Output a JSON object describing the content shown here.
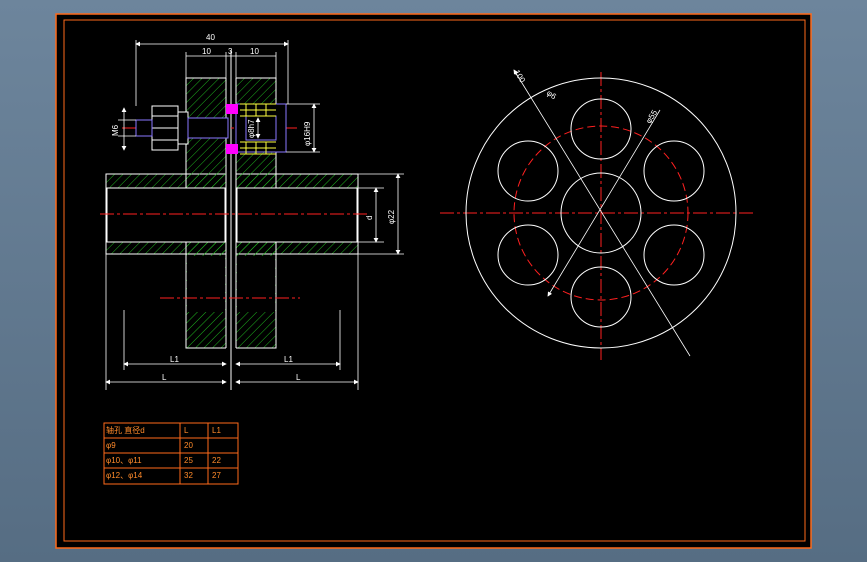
{
  "colors": {
    "background": "#000000",
    "frame": "#ff6a1a",
    "outline": "#ffffff",
    "dimension": "#ffffff",
    "centerline": "#ff2020",
    "hatch": "#1fb51f",
    "bolt": "#8a78ff",
    "bolt_marker": "#ff00ff",
    "spring": "#ffff40",
    "table": "#ff6a1a"
  },
  "dimensions": {
    "overall": "40",
    "left_flange": "10",
    "gap": "3",
    "right_flange": "10",
    "thread": "M6",
    "bolt_pin": "φ8h7",
    "bolt_hole": "φ16H9",
    "bore": "d",
    "hub_dia": "φ22",
    "l1_left": "L1",
    "l1_right": "L1",
    "l_left": "L",
    "l_right": "L",
    "pcd": "φ55",
    "hole_dia": "φ6",
    "outer_dia": "100"
  },
  "table": {
    "header": [
      "轴孔 直径d",
      "L",
      "L1"
    ],
    "rows": [
      [
        "φ9",
        "20",
        ""
      ],
      [
        "φ10、φ11",
        "25",
        "22"
      ],
      [
        "φ12、φ14",
        "32",
        "27"
      ]
    ]
  }
}
